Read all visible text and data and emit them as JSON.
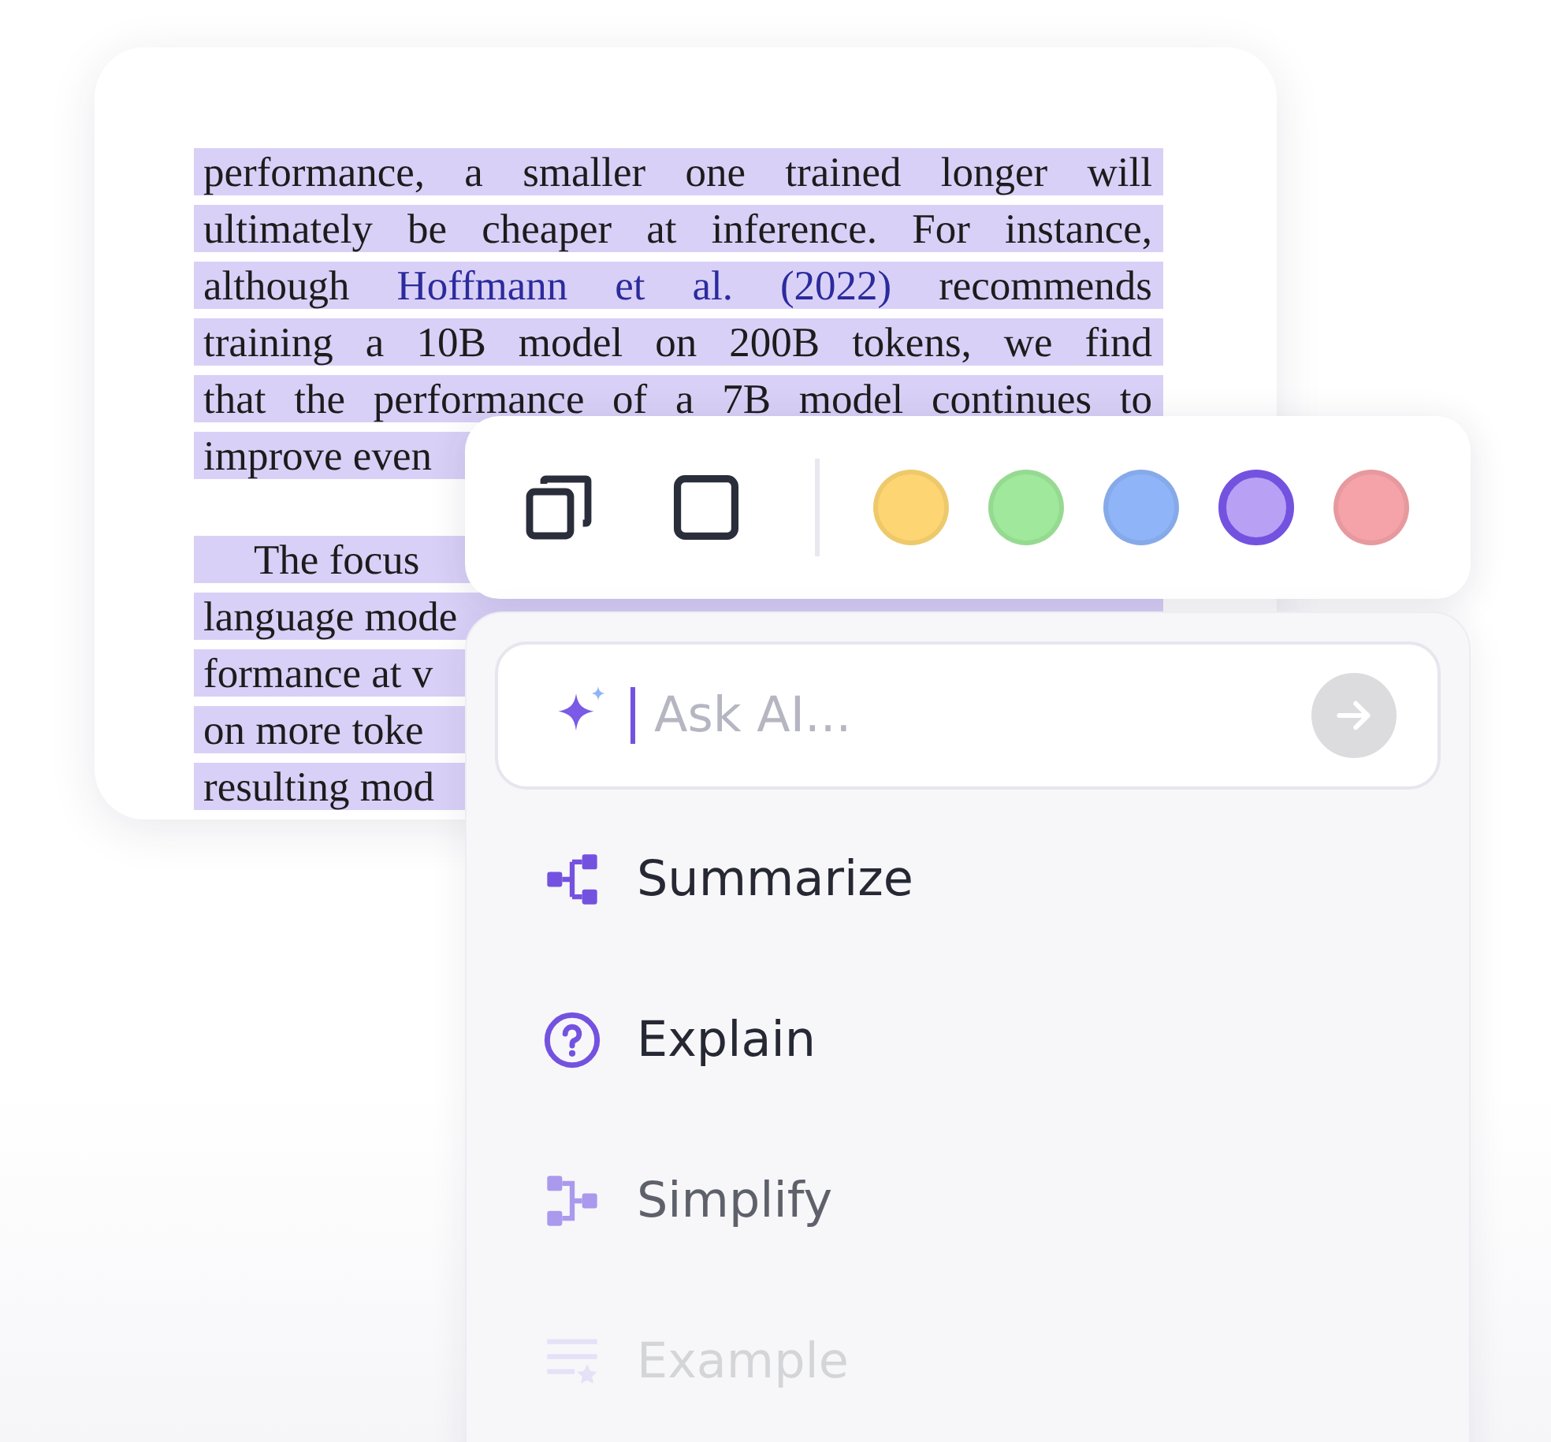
{
  "document": {
    "paragraphs": [
      {
        "indented": false,
        "lines": [
          {
            "kind": "full",
            "segments": [
              {
                "text": "performance, a smaller one trained longer will",
                "link": false
              }
            ]
          },
          {
            "kind": "full",
            "segments": [
              {
                "text": "ultimately be cheaper at inference. For instance,",
                "link": false
              }
            ]
          },
          {
            "kind": "full",
            "segments": [
              {
                "text": "although ",
                "link": false
              },
              {
                "text": "Hoffmann et al. (2022)",
                "link": true
              },
              {
                "text": " recommends",
                "link": false
              }
            ]
          },
          {
            "kind": "full",
            "segments": [
              {
                "text": "training a 10B model on 200B tokens, we find",
                "link": false
              }
            ]
          },
          {
            "kind": "full",
            "segments": [
              {
                "text": "that the performance of a 7B model continues to",
                "link": false
              }
            ]
          },
          {
            "kind": "cut",
            "segments": [
              {
                "text": "improve even",
                "link": false
              }
            ]
          }
        ]
      },
      {
        "indented": true,
        "lines": [
          {
            "kind": "cut",
            "segments": [
              {
                "text": "The focus",
                "link": false
              }
            ]
          },
          {
            "kind": "cut",
            "segments": [
              {
                "text": "language mode",
                "link": false
              }
            ]
          },
          {
            "kind": "cut",
            "segments": [
              {
                "text": "formance at v",
                "link": false
              }
            ]
          },
          {
            "kind": "cut",
            "segments": [
              {
                "text": "on more toke",
                "link": false
              }
            ]
          },
          {
            "kind": "cut",
            "segments": [
              {
                "text": "resulting mod",
                "link": false
              }
            ]
          }
        ]
      }
    ]
  },
  "toolbar": {
    "colors": [
      {
        "color": "#fdd673",
        "selected": false
      },
      {
        "color": "#a0e89c",
        "selected": false
      },
      {
        "color": "#8fb4f8",
        "selected": false
      },
      {
        "color": "#b8a1f5",
        "selected": true
      },
      {
        "color": "#f5a3a8",
        "selected": false
      }
    ]
  },
  "ai_menu": {
    "search": {
      "placeholder": "Ask AI..."
    },
    "items": [
      {
        "kind": "tree",
        "label": "Summarize"
      },
      {
        "kind": "question",
        "label": "Explain"
      },
      {
        "kind": "branch",
        "label": "Simplify"
      },
      {
        "kind": "list",
        "label": "Example"
      }
    ]
  }
}
